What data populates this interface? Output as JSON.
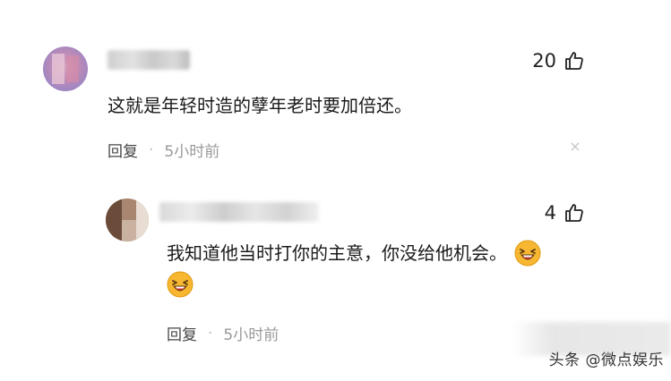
{
  "comments": [
    {
      "likes": "20",
      "text": "这就是年轻时造的孽年老时要加倍还。",
      "reply_label": "回复",
      "separator": "·",
      "time": "5小时前",
      "close_glyph": "×"
    }
  ],
  "reply": {
    "likes": "4",
    "text": "我知道他当时打你的主意，你没给他机会。",
    "reply_label": "回复",
    "separator": "·",
    "time": "5小时前",
    "emojis": [
      "laughing-face-icon",
      "laughing-face-icon"
    ]
  },
  "watermark": {
    "text": "头条 @微点娱乐"
  },
  "colors": {
    "text": "#1a1a1a",
    "meta": "#999999",
    "emoji_face": "#f7b731",
    "emoji_mouth": "#d4332f"
  }
}
